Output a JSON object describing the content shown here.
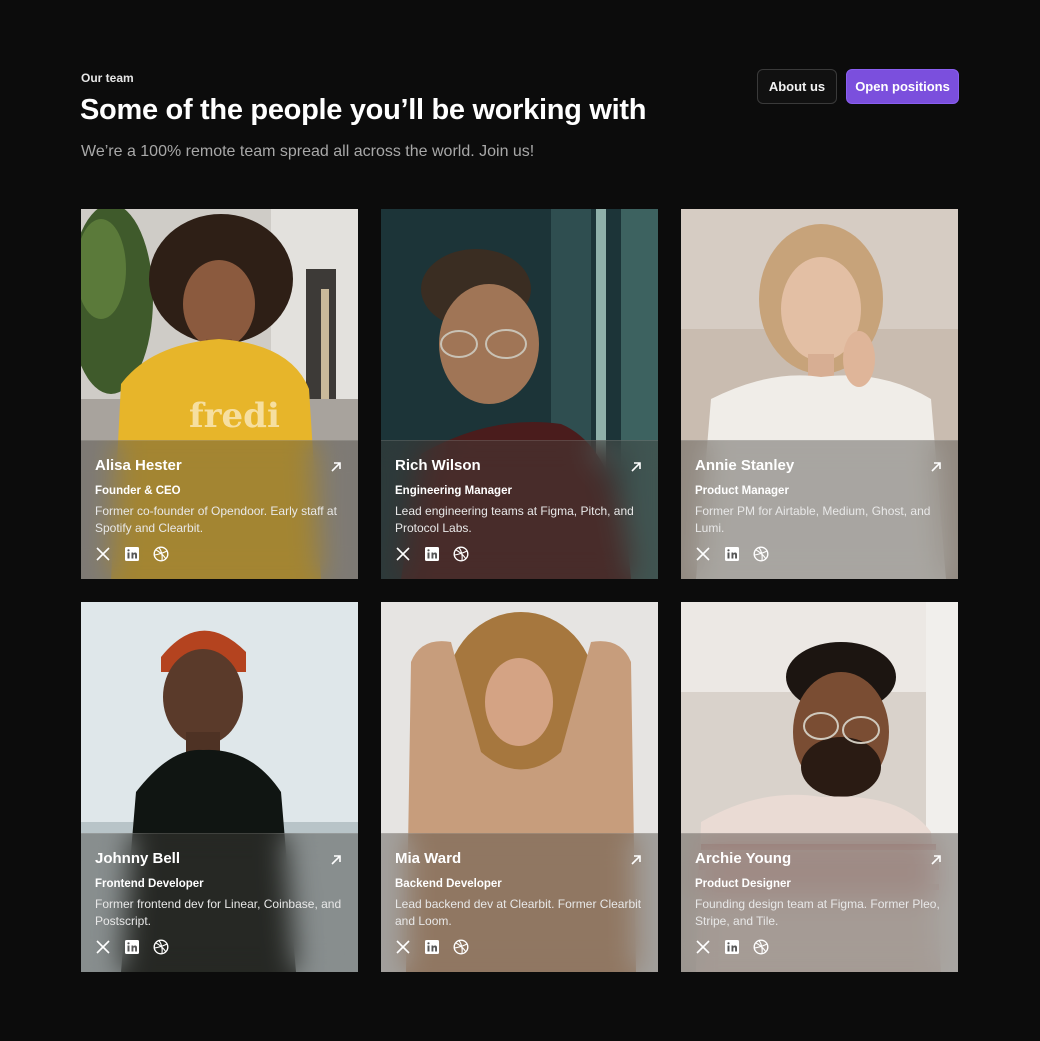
{
  "header": {
    "eyebrow": "Our team",
    "title": "Some of the people you’ll be working with",
    "subtitle": "We’re a 100% remote team spread all across the world. Join us!",
    "about_label": "About us",
    "open_label": "Open positions"
  },
  "colors": {
    "background": "#0c0c0c",
    "accent": "#7b4fdd"
  },
  "team": [
    {
      "name": "Alisa Hester",
      "role": "Founder & CEO",
      "bio": "Former co-founder of Opendoor. Early staff at Spotify and Clearbit."
    },
    {
      "name": "Rich Wilson",
      "role": "Engineering Manager",
      "bio": "Lead engineering teams at Figma, Pitch, and Protocol Labs."
    },
    {
      "name": "Annie Stanley",
      "role": "Product Manager",
      "bio": "Former PM for Airtable, Medium, Ghost, and Lumi."
    },
    {
      "name": "Johnny Bell",
      "role": "Frontend Developer",
      "bio": "Former frontend dev for Linear, Coinbase, and Postscript."
    },
    {
      "name": "Mia Ward",
      "role": "Backend Developer",
      "bio": "Lead backend dev at Clearbit. Former Clearbit and Loom."
    },
    {
      "name": "Archie Young",
      "role": "Product Designer",
      "bio": "Founding design team at Figma. Former Pleo, Stripe, and Tile."
    }
  ],
  "icons": {
    "arrow": "arrow-up-right-icon",
    "social": [
      "x-twitter-icon",
      "linkedin-icon",
      "dribbble-icon"
    ]
  }
}
